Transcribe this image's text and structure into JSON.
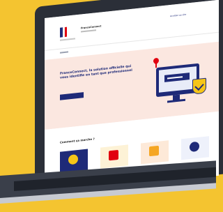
{
  "site": {
    "name": "FranceConnect",
    "header_link": "Accéder au site",
    "hero_title": "FranceConnect, la solution officielle qui vous identifie en tant que professionnel",
    "hero_button": "",
    "section_title": "Comment ça marche ?"
  },
  "icons": {
    "logo": "marianne-flag-logo",
    "pin": "map-pin-icon",
    "monitor": "computer-monitor-icon",
    "shield": "shield-check-icon"
  },
  "colors": {
    "background": "#f4c430",
    "brand_blue": "#1e2a78",
    "brand_red": "#e1000f",
    "hero_bg": "#fbe7e0",
    "accent_yellow": "#f5c518"
  }
}
